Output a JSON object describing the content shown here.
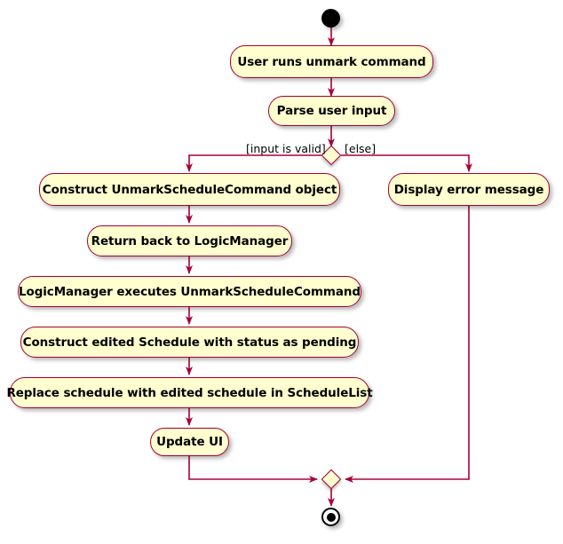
{
  "diagram": {
    "type": "activity-diagram",
    "title": "Unmark command activity diagram",
    "colors": {
      "node_fill": "#FEFECE",
      "node_border": "#A80036",
      "edge": "#A80036",
      "text": "#000000",
      "background": "#FFFFFF",
      "start_node": "#000000",
      "end_node": "#000000"
    },
    "start": {
      "label": "start",
      "shape": "filled-circle"
    },
    "end": {
      "label": "stop",
      "shape": "bullseye"
    },
    "activities": [
      {
        "id": "a1",
        "label": "User runs unmark command"
      },
      {
        "id": "a2",
        "label": "Parse user input"
      },
      {
        "id": "a3",
        "label": "Construct UnmarkScheduleCommand object"
      },
      {
        "id": "a4",
        "label": "Return back to LogicManager"
      },
      {
        "id": "a5",
        "label": "LogicManager executes UnmarkScheduleCommand"
      },
      {
        "id": "a6",
        "label": "Construct edited Schedule with status as pending"
      },
      {
        "id": "a7",
        "label": "Replace schedule with edited schedule in ScheduleList"
      },
      {
        "id": "a8",
        "label": "Update UI"
      },
      {
        "id": "a9",
        "label": "Display error message"
      }
    ],
    "decision": {
      "shape": "diamond",
      "guard_true": "[input is valid]",
      "guard_false": "[else]"
    },
    "merge": {
      "shape": "diamond",
      "label": ""
    },
    "flows": [
      {
        "from": "start",
        "to": "a1"
      },
      {
        "from": "a1",
        "to": "a2"
      },
      {
        "from": "a2",
        "to": "decision"
      },
      {
        "from": "decision",
        "to": "a3",
        "guard": "[input is valid]"
      },
      {
        "from": "decision",
        "to": "a9",
        "guard": "[else]"
      },
      {
        "from": "a3",
        "to": "a4"
      },
      {
        "from": "a4",
        "to": "a5"
      },
      {
        "from": "a5",
        "to": "a6"
      },
      {
        "from": "a6",
        "to": "a7"
      },
      {
        "from": "a7",
        "to": "a8"
      },
      {
        "from": "a8",
        "to": "merge"
      },
      {
        "from": "a9",
        "to": "merge"
      },
      {
        "from": "merge",
        "to": "end"
      }
    ]
  }
}
